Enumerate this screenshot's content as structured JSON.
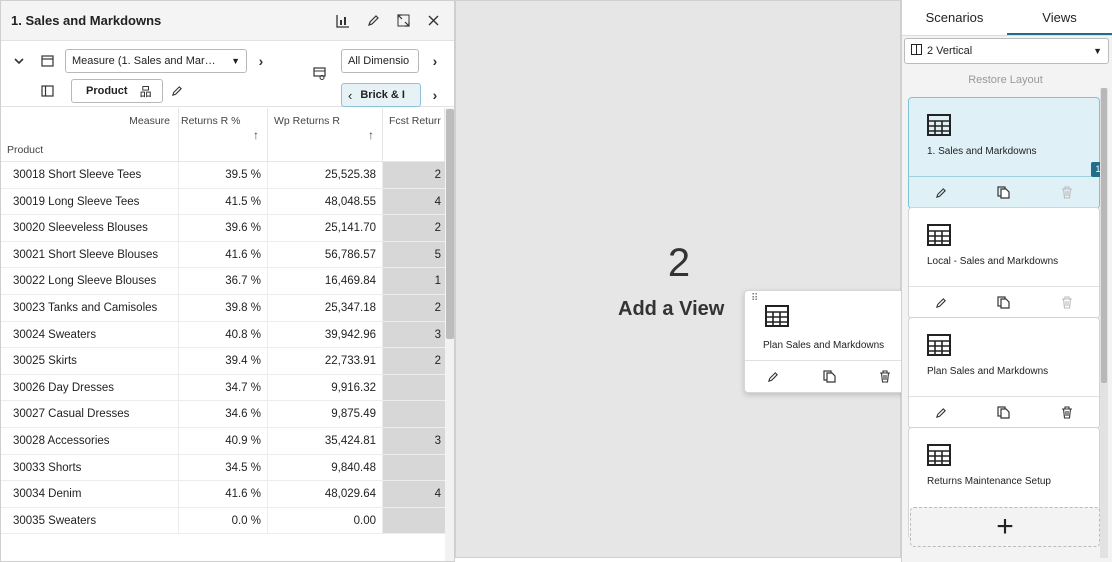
{
  "view1": {
    "title": "1. Sales and Markdowns",
    "measure_dropdown": "Measure (1. Sales and Mar…",
    "product_pill": "Product",
    "dims_dropdown": "All Dimensio",
    "brick_pill": "Brick & I",
    "measure_label": "Measure",
    "product_label": "Product",
    "columns": [
      "Returns R %",
      "Wp Returns R",
      "Fcst Returr"
    ],
    "rows": [
      {
        "product": "30018 Short Sleeve Tees",
        "returns_pct": "39.5 %",
        "wp_returns": "25,525.38",
        "fcst": "2"
      },
      {
        "product": "30019 Long Sleeve Tees",
        "returns_pct": "41.5 %",
        "wp_returns": "48,048.55",
        "fcst": "4"
      },
      {
        "product": "30020 Sleeveless Blouses",
        "returns_pct": "39.6 %",
        "wp_returns": "25,141.70",
        "fcst": "2"
      },
      {
        "product": "30021 Short Sleeve Blouses",
        "returns_pct": "41.6 %",
        "wp_returns": "56,786.57",
        "fcst": "5"
      },
      {
        "product": "30022 Long Sleeve Blouses",
        "returns_pct": "36.7 %",
        "wp_returns": "16,469.84",
        "fcst": "1"
      },
      {
        "product": "30023 Tanks and Camisoles",
        "returns_pct": "39.8 %",
        "wp_returns": "25,347.18",
        "fcst": "2"
      },
      {
        "product": "30024 Sweaters",
        "returns_pct": "40.8 %",
        "wp_returns": "39,942.96",
        "fcst": "3"
      },
      {
        "product": "30025 Skirts",
        "returns_pct": "39.4 %",
        "wp_returns": "22,733.91",
        "fcst": "2"
      },
      {
        "product": "30026 Day Dresses",
        "returns_pct": "34.7 %",
        "wp_returns": "9,916.32",
        "fcst": ""
      },
      {
        "product": "30027 Casual Dresses",
        "returns_pct": "34.6 %",
        "wp_returns": "9,875.49",
        "fcst": ""
      },
      {
        "product": "30028 Accessories",
        "returns_pct": "40.9 %",
        "wp_returns": "35,424.81",
        "fcst": "3"
      },
      {
        "product": "30033 Shorts",
        "returns_pct": "34.5 %",
        "wp_returns": "9,840.48",
        "fcst": ""
      },
      {
        "product": "30034 Denim",
        "returns_pct": "41.6 %",
        "wp_returns": "48,029.64",
        "fcst": "4"
      },
      {
        "product": "30035 Sweaters",
        "returns_pct": "0.0 %",
        "wp_returns": "0.00",
        "fcst": ""
      }
    ]
  },
  "slot2": {
    "number": "2",
    "label": "Add a View"
  },
  "drag_card": {
    "name": "Plan Sales and Markdowns"
  },
  "right_panel": {
    "tabs": [
      "Scenarios",
      "Views"
    ],
    "layout": "2 Vertical",
    "restore": "Restore Layout",
    "cards": [
      {
        "name": "1. Sales and Markdowns",
        "badge": "1"
      },
      {
        "name": "Local - Sales and Markdowns"
      },
      {
        "name": "Plan Sales and Markdowns"
      },
      {
        "name": "Returns Maintenance Setup"
      }
    ],
    "add_label": "+"
  },
  "colors": {
    "accent": "#1f6f8b",
    "active_card": "#dff1f7",
    "slot_bg": "#e6e6e6"
  }
}
